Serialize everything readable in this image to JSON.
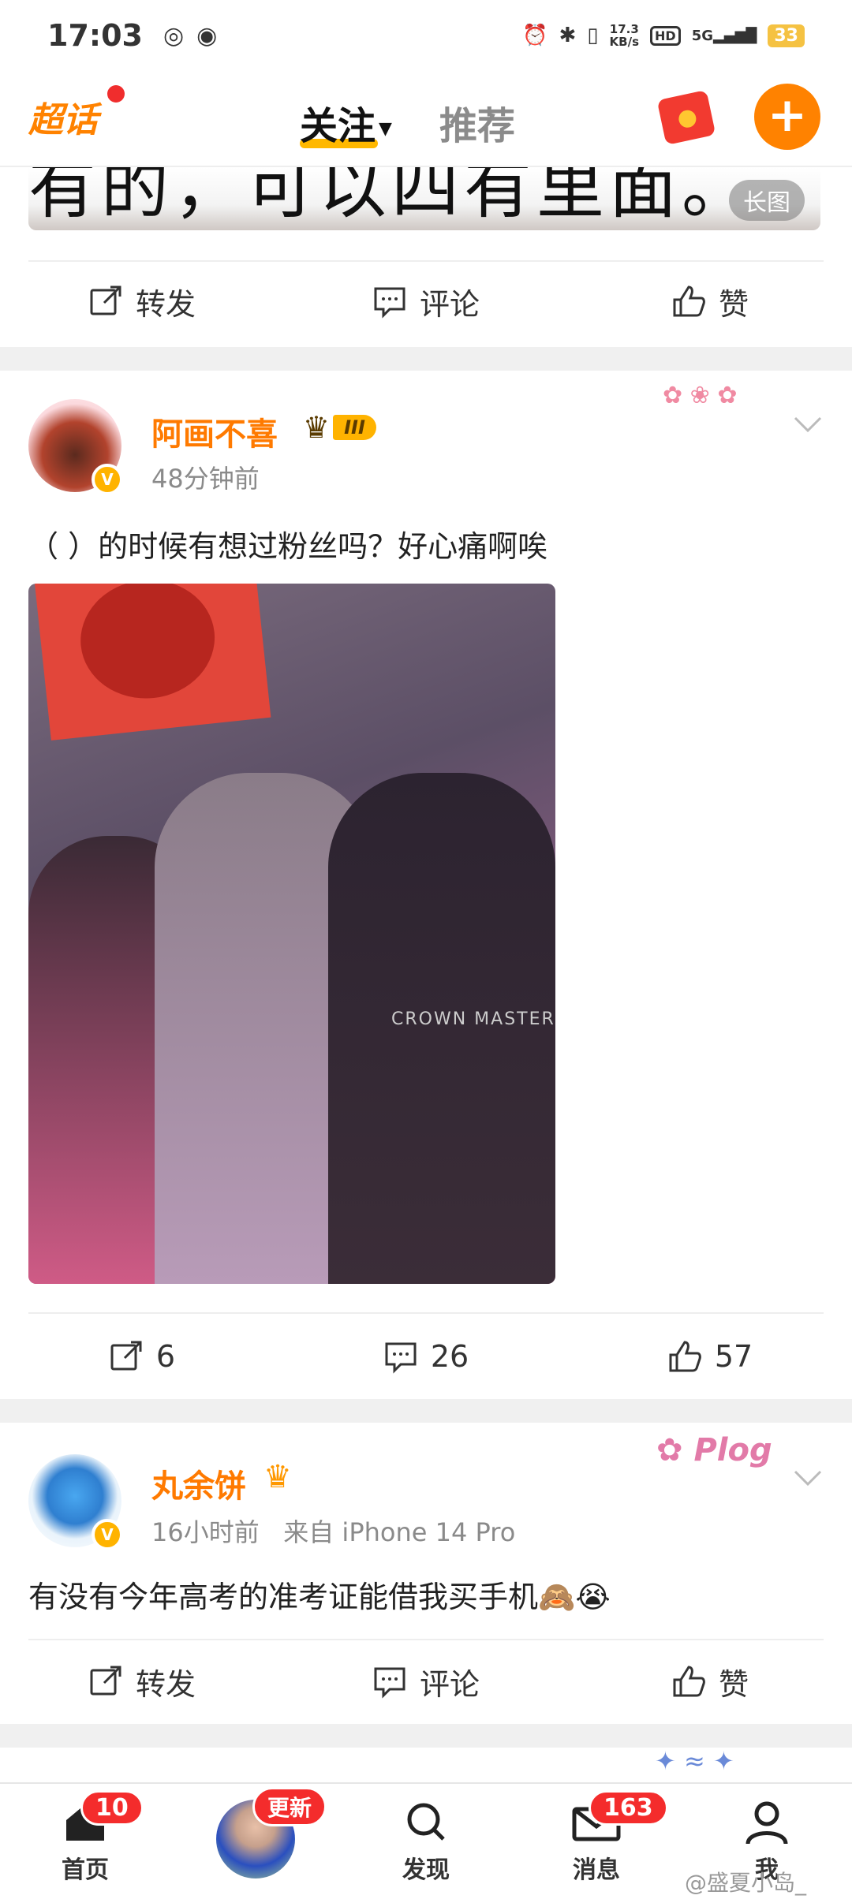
{
  "status_bar": {
    "time": "17:03",
    "net_speed": "17.3",
    "net_unit": "KB/s",
    "hd": "HD",
    "network": "5G",
    "battery": "33"
  },
  "top_nav": {
    "chaohua_label": "超话",
    "tab_follow": "关注",
    "tab_recommend": "推荐",
    "add_icon": "plus-icon",
    "accent": "#ff8200"
  },
  "prev_post": {
    "image_text": "有的，可以四有里面。",
    "long_image_label": "长图",
    "actions": {
      "repost": "转发",
      "comment": "评论",
      "like": "赞"
    }
  },
  "post1": {
    "username": "阿画不喜",
    "level_badge": "III",
    "time": "48分钟前",
    "text": "（ ）的时候有想过粉丝吗？好心痛啊唉",
    "photo_text": "CROWN MASTER",
    "actions": {
      "repost": "6",
      "comment": "26",
      "like": "57"
    }
  },
  "post2": {
    "username": "丸余饼",
    "time": "16小时前",
    "source": "来自 iPhone 14 Pro",
    "sticker": "Plog",
    "text": "有没有今年高考的准考证能借我买手机🙈😭",
    "actions": {
      "repost": "转发",
      "comment": "评论",
      "like": "赞"
    }
  },
  "bottom_nav": {
    "home_label": "首页",
    "home_badge": "10",
    "update_badge": "更新",
    "discover_label": "发现",
    "messages_label": "消息",
    "messages_badge": "163",
    "me_label": "我"
  },
  "watermark": "@盛夏小岛_"
}
